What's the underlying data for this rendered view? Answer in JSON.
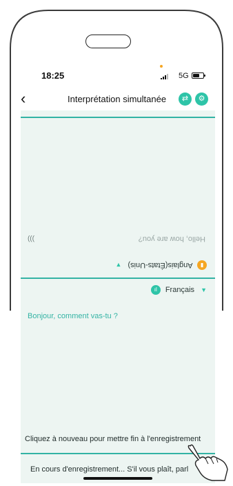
{
  "status_bar": {
    "time": "18:25",
    "network": "5G"
  },
  "nav": {
    "back_icon": "chevron-left-icon",
    "title": "Interprétation simultanée",
    "icons": [
      "translate-icon",
      "gear-icon"
    ]
  },
  "top_panel": {
    "source_text": "Hello, how are you?",
    "language_label": "Anglais(États-Unis)"
  },
  "bottom_panel": {
    "language_label": "Français",
    "translated_text": "Bonjour, comment vas-tu ?"
  },
  "hint": {
    "text": "Cliquez à nouveau pour mettre fin à l'enregistrement"
  },
  "status": {
    "text": "En cours d'enregistrement... S'il vous plaît, parl"
  },
  "colors": {
    "accent": "#33b3a4",
    "accent_icon": "#2ec4a8",
    "mic_orange": "#f5a623",
    "screen_bg": "#edf5f2"
  }
}
